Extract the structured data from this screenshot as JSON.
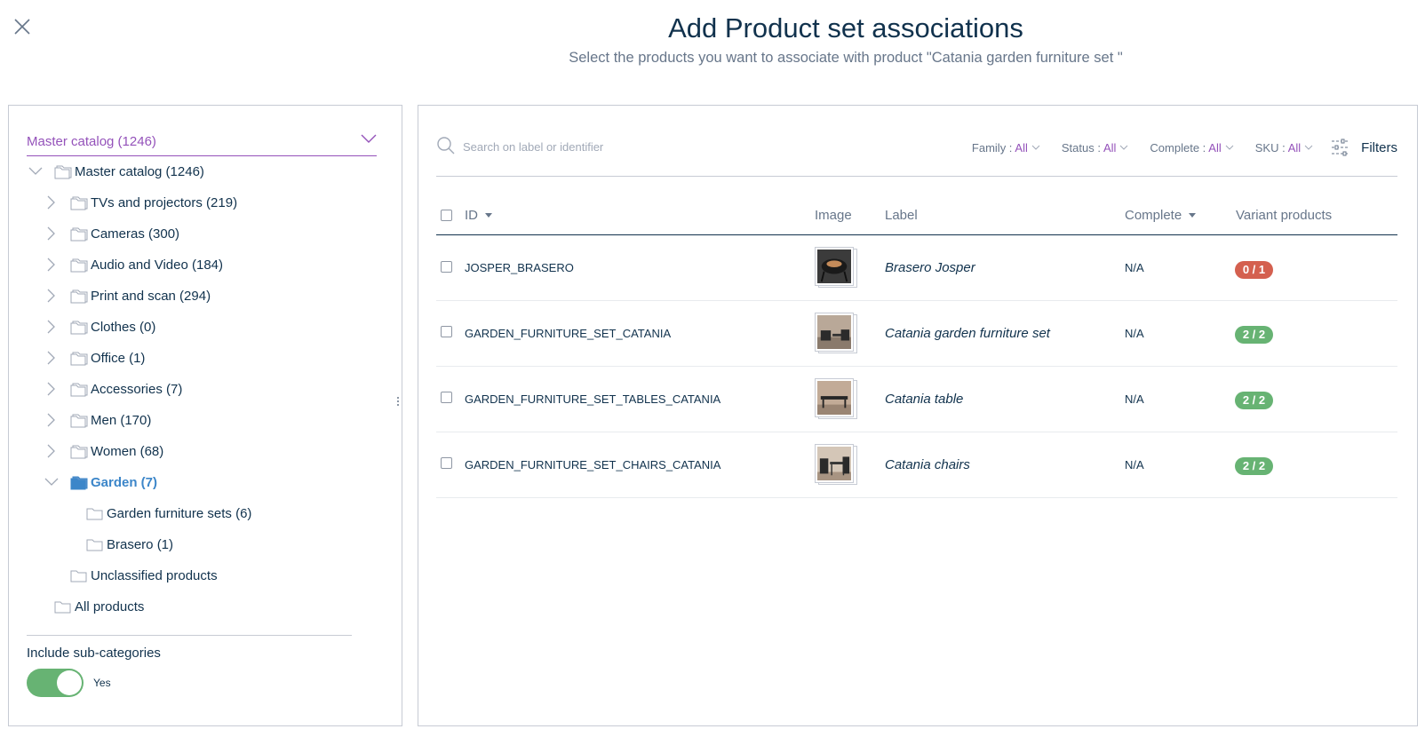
{
  "header": {
    "title": "Add Product set associations",
    "subtitle": "Select the products you want to associate with product \"Catania garden furniture set \""
  },
  "catalog": {
    "selected": "Master catalog (1246)"
  },
  "tree": {
    "root": "Master catalog (1246)",
    "items": [
      "TVs and projectors (219)",
      "Cameras (300)",
      "Audio and Video (184)",
      "Print and scan (294)",
      "Clothes (0)",
      "Office (1)",
      "Accessories (7)",
      "Men (170)",
      "Women (68)",
      "Garden (7)"
    ],
    "garden_children": [
      "Garden furniture sets (6)",
      "Brasero (1)"
    ],
    "unclassified": "Unclassified products",
    "all_products": "All products",
    "include_sub_label": "Include sub-categories",
    "include_sub_value": "Yes"
  },
  "search": {
    "placeholder": "Search on label or identifier"
  },
  "filters": [
    {
      "label": "Family :",
      "value": "All"
    },
    {
      "label": "Status :",
      "value": "All"
    },
    {
      "label": "Complete :",
      "value": "All"
    },
    {
      "label": "SKU :",
      "value": "All"
    }
  ],
  "filters_button": "Filters",
  "table": {
    "headers": {
      "id": "ID",
      "image": "Image",
      "label": "Label",
      "complete": "Complete",
      "variants": "Variant products"
    },
    "rows": [
      {
        "id": "JOSPER_BRASERO",
        "label": "Brasero Josper",
        "complete": "N/A",
        "variants": "0 / 1",
        "status": "red",
        "image": "brasero-image"
      },
      {
        "id": "GARDEN_FURNITURE_SET_CATANIA",
        "label": "Catania garden furniture set",
        "complete": "N/A",
        "variants": "2 / 2",
        "status": "green",
        "image": "furniture-set-image"
      },
      {
        "id": "GARDEN_FURNITURE_SET_TABLES_CATANIA",
        "label": "Catania table",
        "complete": "N/A",
        "variants": "2 / 2",
        "status": "green",
        "image": "table-image"
      },
      {
        "id": "GARDEN_FURNITURE_SET_CHAIRS_CATANIA",
        "label": "Catania chairs",
        "complete": "N/A",
        "variants": "2 / 2",
        "status": "green",
        "image": "chairs-image"
      }
    ]
  },
  "colors": {
    "accent": "#9452ba",
    "selected_node": "#3c86c9",
    "toggle_on": "#67b373",
    "badge_red": "#d4604f",
    "badge_green": "#67b373",
    "text": "#11324d"
  }
}
